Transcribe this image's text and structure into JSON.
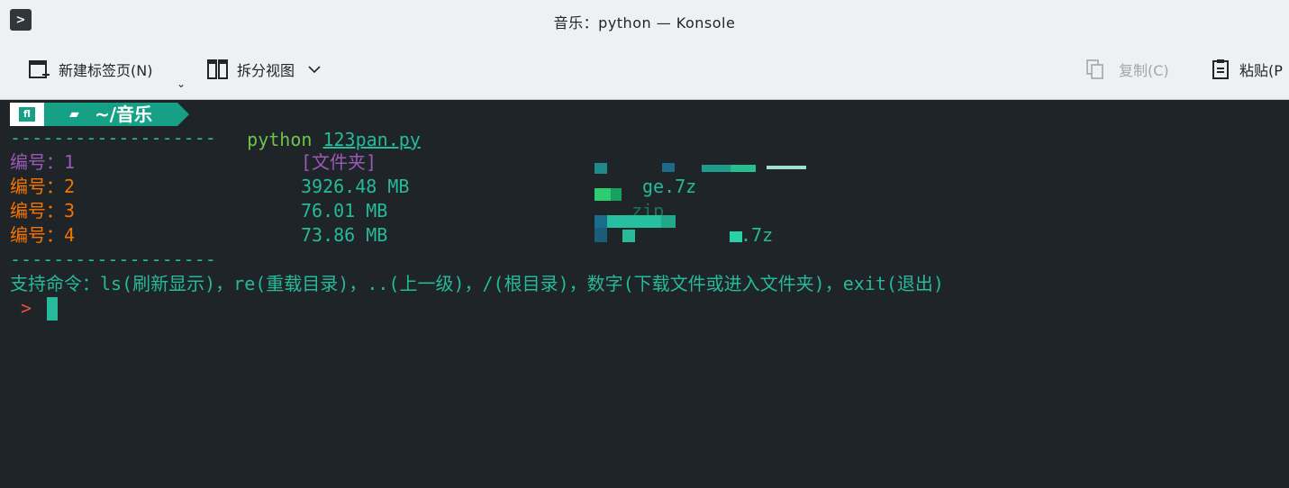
{
  "window": {
    "title": "音乐：python — Konsole"
  },
  "toolbar": {
    "new_tab": "新建标签页(N)",
    "split_view": "拆分视图",
    "copy": "复制(C)",
    "paste": "粘贴(P"
  },
  "terminal": {
    "prompt_dir": "~/音乐",
    "command": "python",
    "script": "123pan.py",
    "separator": "-------------------",
    "rows": [
      {
        "label": "编号：1",
        "size": "[文件夹]",
        "name": ""
      },
      {
        "label": "编号：2",
        "size": "3926.48 MB",
        "name": "ge.7z"
      },
      {
        "label": "编号：3",
        "size": "76.01 MB",
        "name": "zip"
      },
      {
        "label": "编号：4",
        "size": "73.86 MB",
        "name": ".7z"
      }
    ],
    "help": "支持命令：ls(刷新显示)，re(重载目录)，..(上一级)，/(根目录)，数字(下载文件或进入文件夹)，exit(退出)",
    "input_prompt": ">"
  },
  "colors": {
    "accent": "#26b99a",
    "folder": "#9b59b6",
    "file": "#f67400",
    "command": "#6cc54c"
  }
}
